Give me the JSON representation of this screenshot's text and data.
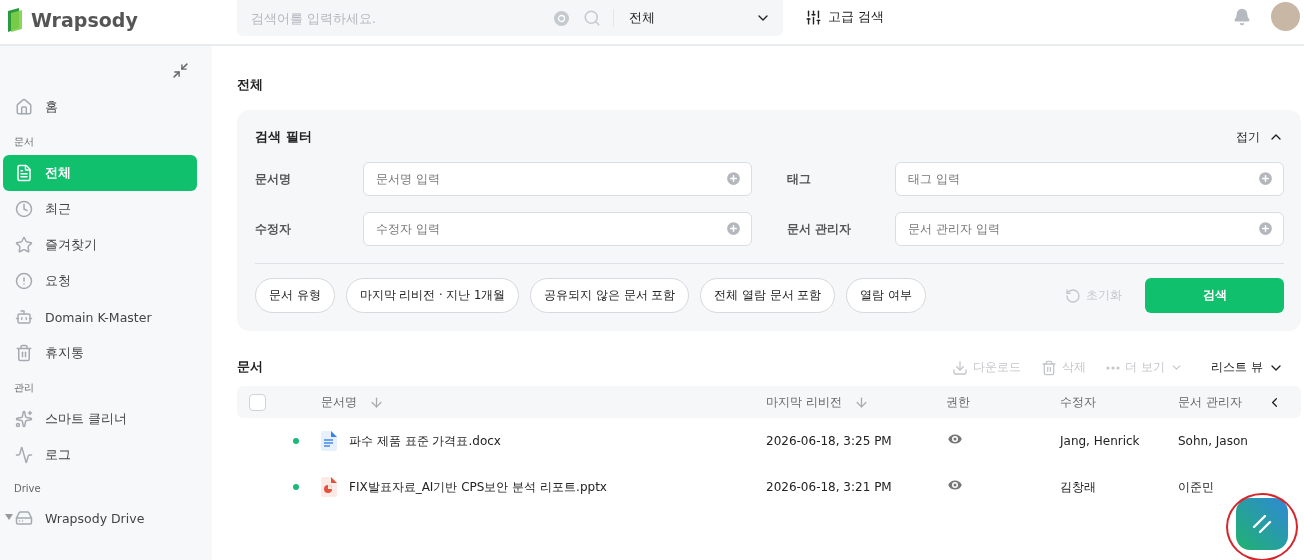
{
  "header": {
    "logo": "Wrapsody",
    "search": {
      "placeholder": "검색어를 입력하세요.",
      "scope": "전체"
    },
    "advanced": "고급 검색"
  },
  "sidebar": {
    "sections": [
      {
        "items": [
          {
            "label": "홈",
            "selected": false
          }
        ]
      },
      {
        "title": "문서",
        "items": [
          {
            "label": "전체",
            "selected": true
          },
          {
            "label": "최근",
            "selected": false
          },
          {
            "label": "즐겨찾기",
            "selected": false
          },
          {
            "label": "요청",
            "selected": false
          },
          {
            "label": "Domain K-Master",
            "selected": false
          },
          {
            "label": "휴지통",
            "selected": false
          }
        ]
      },
      {
        "title": "관리",
        "items": [
          {
            "label": "스마트 클리너",
            "selected": false
          },
          {
            "label": "로그",
            "selected": false
          }
        ]
      },
      {
        "title": "Drive",
        "items": [
          {
            "label": "Wrapsody Drive",
            "selected": false,
            "expanded": true
          }
        ]
      }
    ]
  },
  "page_title": "전체",
  "filter": {
    "title": "검색 필터",
    "toggle": "접기",
    "expanded": true,
    "fields": [
      {
        "label": "문서명",
        "placeholder": "문서명 입력"
      },
      {
        "label": "태그",
        "placeholder": "태그 입력"
      },
      {
        "label": "수정자",
        "placeholder": "수정자 입력"
      },
      {
        "label": "문서 관리자",
        "placeholder": "문서 관리자 입력"
      }
    ],
    "chips": [
      "문서 유형",
      "마지막 리비전 · 지난 1개월",
      "공유되지 않은 문서 포함",
      "전체 열람 문서 포함",
      "열람 여부"
    ],
    "reset": {
      "label": "초기화",
      "disabled": true
    },
    "submit": "검색"
  },
  "documents": {
    "title": "문서",
    "actions": [
      {
        "label": "다운로드",
        "disabled": true
      },
      {
        "label": "삭제",
        "disabled": true
      },
      {
        "label": "더 보기",
        "disabled": true
      }
    ],
    "view": "리스트 뷰",
    "select_all": {
      "checked": false
    },
    "columns": [
      {
        "label": "문서명",
        "sorted": true
      },
      {
        "label": "마지막 리비전",
        "sorted": true
      },
      {
        "label": "권한",
        "sorted": false
      },
      {
        "label": "수정자",
        "sorted": false
      },
      {
        "label": "문서 관리자",
        "sorted": false
      }
    ],
    "rows": [
      {
        "unread": true,
        "file": {
          "kind": "docx"
        },
        "name": "파수 제품 표준 가격표.docx",
        "revision": "2026-06-18, 3:25 PM",
        "permission": {
          "kind": "view"
        },
        "editor": "Jang, Henrick",
        "manager": "Sohn, Jason"
      },
      {
        "unread": true,
        "file": {
          "kind": "pptx"
        },
        "name": "FIX발표자료_AI기반 CPS보안 분석 리포트.pptx",
        "revision": "2026-06-18, 3:21 PM",
        "permission": {
          "kind": "view"
        },
        "editor": "김창래",
        "manager": "이준민"
      }
    ]
  }
}
